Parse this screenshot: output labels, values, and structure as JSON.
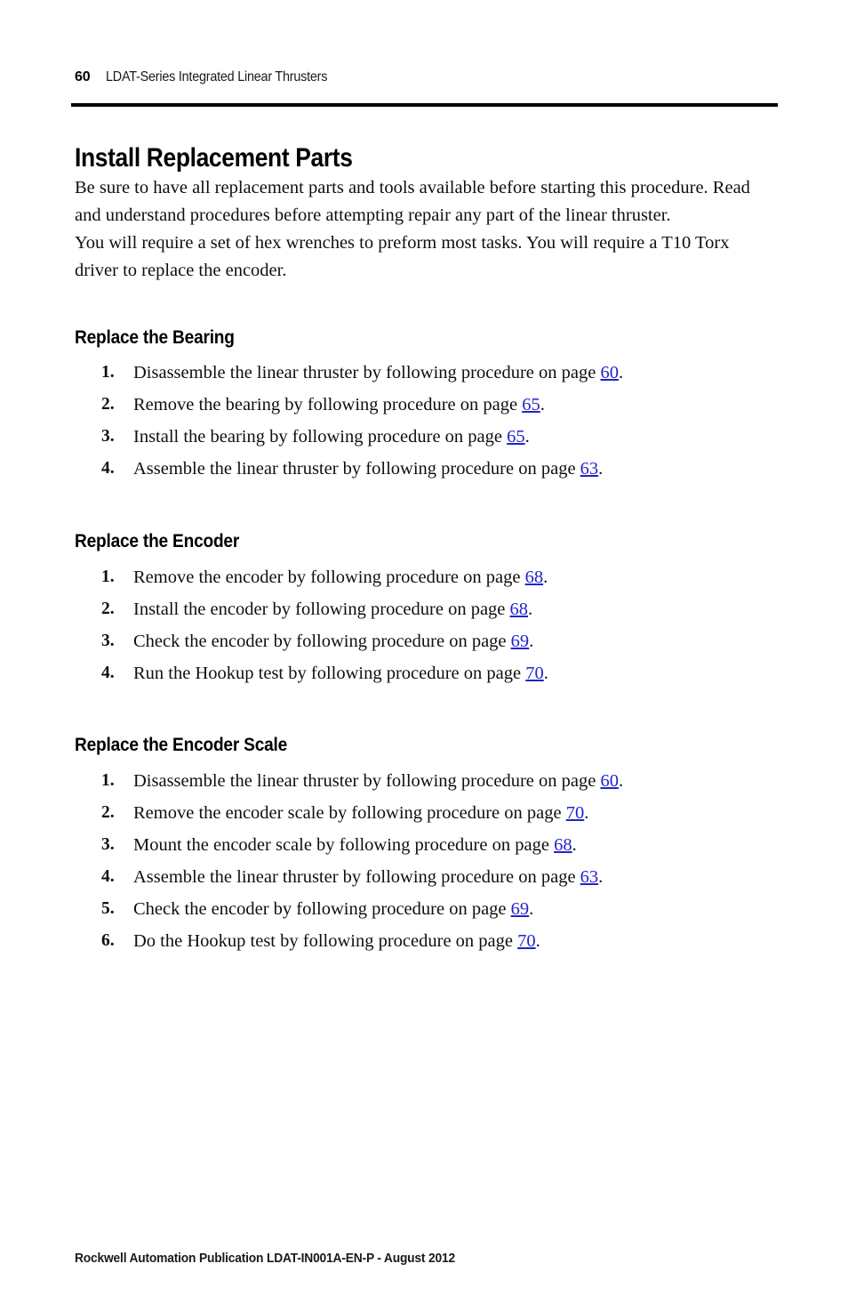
{
  "document": {
    "header": {
      "folio": "60",
      "title": "LDAT-Series Integrated Linear Thrusters"
    },
    "chapter_title": "Install Replacement Parts",
    "paragraphs": [
      "Be sure to have all replacement parts and tools available before starting this procedure. Read and understand procedures before attempting repair any part of the linear thruster.",
      "You will require a set of hex wrenches to preform most tasks. You will require a T10 Torx driver to replace the encoder."
    ],
    "sections": [
      {
        "heading": "Replace the Bearing",
        "items": [
          {
            "num": "1.",
            "lead": "Disassemble the linear thruster by following procedure on page ",
            "link": "60",
            "tail": "."
          },
          {
            "num": "2.",
            "lead": "Remove the bearing by following procedure on page ",
            "link": "65",
            "tail": "."
          },
          {
            "num": "3.",
            "lead": "Install the bearing by following procedure on page ",
            "link": "65",
            "tail": "."
          },
          {
            "num": "4.",
            "lead": "Assemble the linear thruster by following procedure on page ",
            "link": "63",
            "tail": "."
          }
        ]
      },
      {
        "heading": "Replace the Encoder",
        "items": [
          {
            "num": "1.",
            "lead": "Remove the encoder by following procedure on page ",
            "link": "68",
            "tail": "."
          },
          {
            "num": "2.",
            "lead": "Install the encoder by following procedure on page ",
            "link": "68",
            "tail": "."
          },
          {
            "num": "3.",
            "lead": "Check the encoder by following procedure on page ",
            "link": "69",
            "tail": "."
          },
          {
            "num": "4.",
            "lead": "Run the Hookup test by following procedure on page ",
            "link": "70",
            "tail": "."
          }
        ]
      },
      {
        "heading": "Replace the Encoder Scale",
        "items": [
          {
            "num": "1.",
            "lead": "Disassemble the linear thruster by following procedure on page ",
            "link": "60",
            "tail": "."
          },
          {
            "num": "2.",
            "lead": "Remove the encoder scale by following procedure on page ",
            "link": "70",
            "tail": "."
          },
          {
            "num": "3.",
            "lead": "Mount the encoder scale by following procedure on page ",
            "link": "68",
            "tail": "."
          },
          {
            "num": "4.",
            "lead": "Assemble the linear thruster by following procedure on page ",
            "link": "63",
            "tail": "."
          },
          {
            "num": "5.",
            "lead": "Check the encoder by following procedure on page ",
            "link": "69",
            "tail": "."
          },
          {
            "num": "6.",
            "lead": "Do the Hookup test by following procedure on page ",
            "link": "70",
            "tail": "."
          }
        ]
      }
    ],
    "footer": "Rockwell Automation Publication LDAT-IN001A-EN-P - August 2012",
    "colors": {
      "link": "#2222cc",
      "text": "#100f0d",
      "rule": "#000000",
      "background": "#ffffff"
    }
  }
}
